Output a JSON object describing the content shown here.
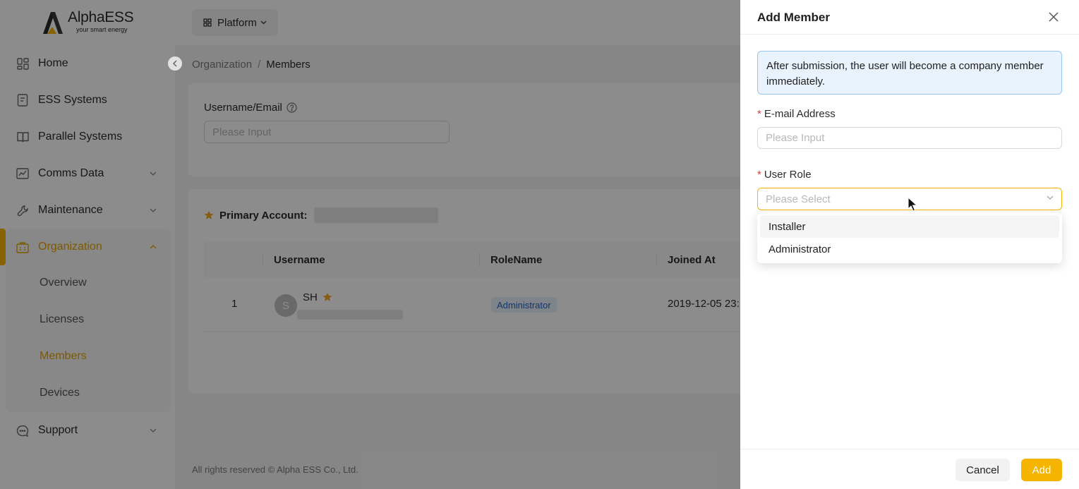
{
  "brand": {
    "name": "AlphaESS",
    "tagline": "your smart energy",
    "accent_color": "#f5b400"
  },
  "sidebar": {
    "items": [
      {
        "label": "Home",
        "icon": "home-grid-icon"
      },
      {
        "label": "ESS Systems",
        "icon": "document-icon"
      },
      {
        "label": "Parallel Systems",
        "icon": "book-icon"
      },
      {
        "label": "Comms Data",
        "icon": "chart-icon",
        "expandable": true
      },
      {
        "label": "Maintenance",
        "icon": "wrench-icon",
        "expandable": true
      },
      {
        "label": "Organization",
        "icon": "building-icon",
        "expandable": true,
        "expanded": true,
        "active": true
      },
      {
        "label": "Support",
        "icon": "support-chat-icon",
        "expandable": true
      }
    ],
    "organization_children": [
      "Overview",
      "Licenses",
      "Members",
      "Devices"
    ],
    "active_child": "Members"
  },
  "topbar": {
    "platform_label": "Platform"
  },
  "breadcrumb": {
    "parent": "Organization",
    "separator": "/",
    "current": "Members"
  },
  "filter": {
    "label": "Username/Email",
    "placeholder": "Please Input"
  },
  "members_table": {
    "primary_account_label": "Primary Account:",
    "columns": [
      "Username",
      "RoleName",
      "Joined At"
    ],
    "rows": [
      {
        "index": "1",
        "avatar_initial": "S",
        "username": "SH",
        "role": "Administrator",
        "joined_at": "2019-12-05 23:"
      }
    ]
  },
  "footer": {
    "text": "All rights reserved © Alpha ESS Co., Ltd."
  },
  "drawer": {
    "title": "Add Member",
    "info": "After submission, the user will become a company member immediately.",
    "email_label": "E-mail Address",
    "email_placeholder": "Please Input",
    "role_label": "User Role",
    "role_placeholder": "Please Select",
    "role_options": [
      "Installer",
      "Administrator"
    ],
    "required_mark": "*",
    "cancel_label": "Cancel",
    "add_label": "Add"
  }
}
